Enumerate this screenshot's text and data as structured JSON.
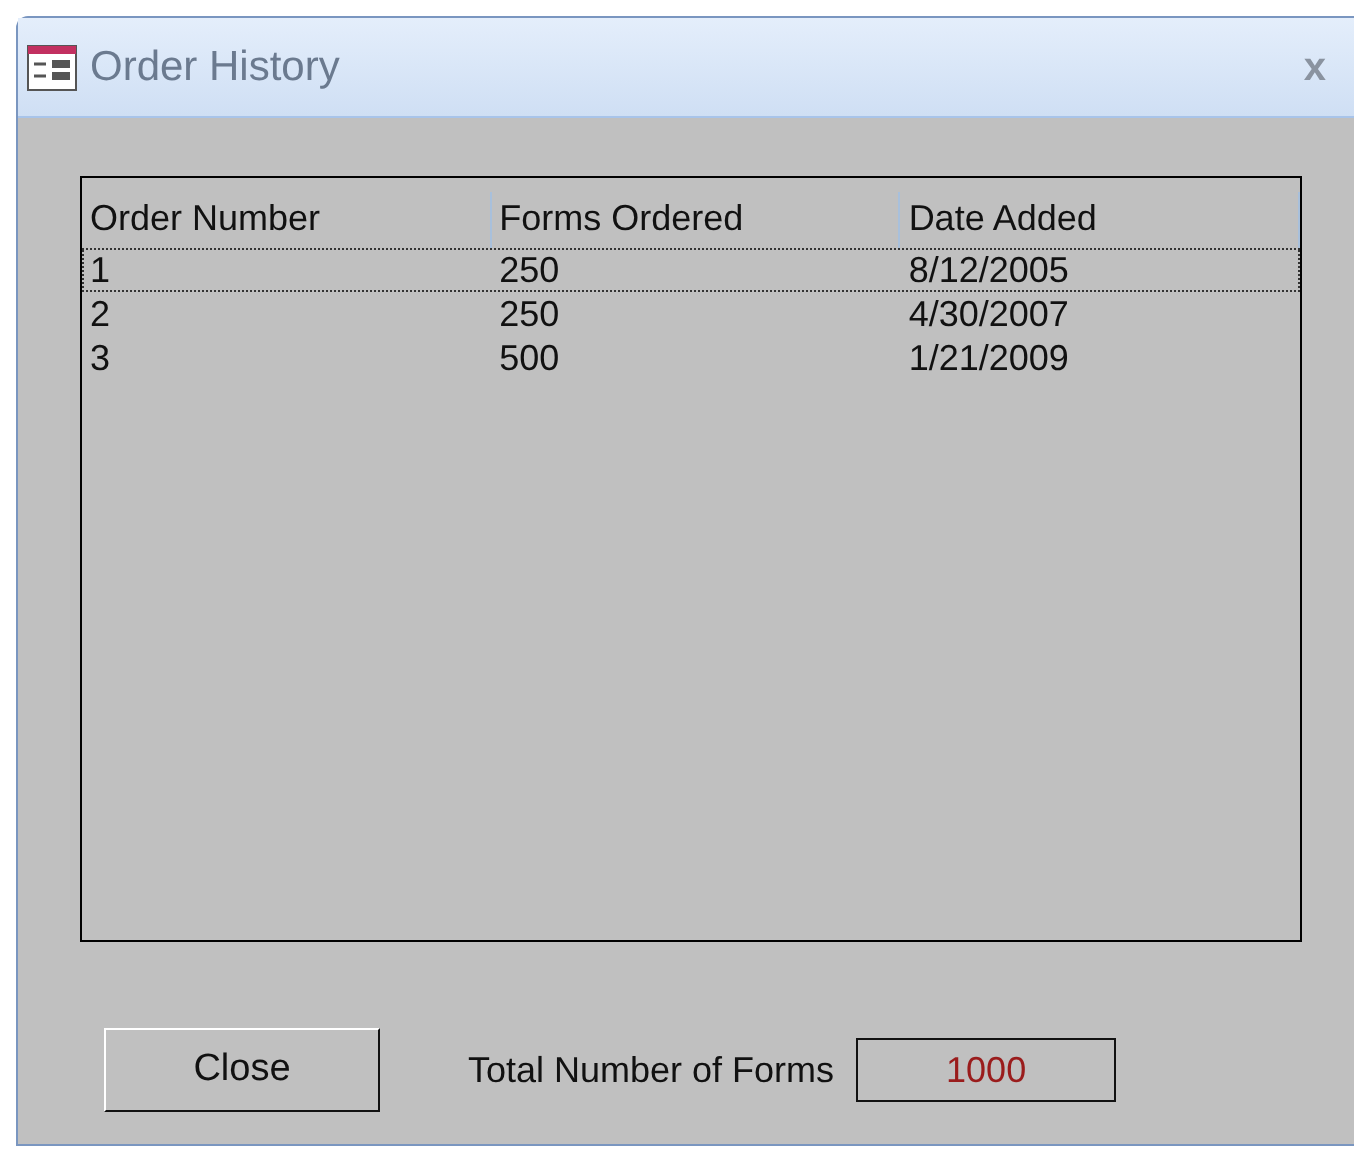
{
  "window": {
    "title": "Order History",
    "close": "x"
  },
  "list": {
    "columns": [
      "Order Number",
      "Forms Ordered",
      "Date Added"
    ],
    "rows": [
      {
        "cells": [
          "1",
          "250",
          "8/12/2005"
        ],
        "selected": true
      },
      {
        "cells": [
          "2",
          "250",
          "4/30/2007"
        ],
        "selected": false
      },
      {
        "cells": [
          "3",
          "500",
          "1/21/2009"
        ],
        "selected": false
      }
    ]
  },
  "close_button": "Close",
  "total": {
    "label": "Total Number of Forms",
    "value": "1000"
  }
}
